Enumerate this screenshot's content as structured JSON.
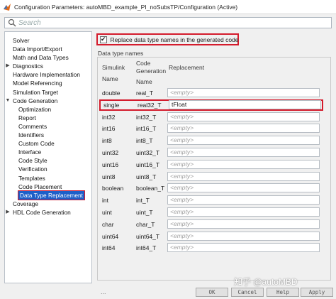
{
  "window": {
    "title": "Configuration Parameters: autoMBD_example_PI_noSubsTP/Configuration (Active)"
  },
  "search": {
    "placeholder": "Search"
  },
  "tree": {
    "items": [
      {
        "label": "Solver",
        "indent": 0,
        "toggle": ""
      },
      {
        "label": "Data Import/Export",
        "indent": 0,
        "toggle": ""
      },
      {
        "label": "Math and Data Types",
        "indent": 0,
        "toggle": ""
      },
      {
        "label": "Diagnostics",
        "indent": 0,
        "toggle": "▶"
      },
      {
        "label": "Hardware Implementation",
        "indent": 0,
        "toggle": ""
      },
      {
        "label": "Model Referencing",
        "indent": 0,
        "toggle": ""
      },
      {
        "label": "Simulation Target",
        "indent": 0,
        "toggle": ""
      },
      {
        "label": "Code Generation",
        "indent": 0,
        "toggle": "▼"
      },
      {
        "label": "Optimization",
        "indent": 1,
        "toggle": ""
      },
      {
        "label": "Report",
        "indent": 1,
        "toggle": ""
      },
      {
        "label": "Comments",
        "indent": 1,
        "toggle": ""
      },
      {
        "label": "Identifiers",
        "indent": 1,
        "toggle": ""
      },
      {
        "label": "Custom Code",
        "indent": 1,
        "toggle": ""
      },
      {
        "label": "Interface",
        "indent": 1,
        "toggle": ""
      },
      {
        "label": "Code Style",
        "indent": 1,
        "toggle": ""
      },
      {
        "label": "Verification",
        "indent": 1,
        "toggle": ""
      },
      {
        "label": "Templates",
        "indent": 1,
        "toggle": ""
      },
      {
        "label": "Code Placement",
        "indent": 1,
        "toggle": ""
      },
      {
        "label": "Data Type Replacement",
        "indent": 1,
        "toggle": "",
        "selected": true
      },
      {
        "label": "Coverage",
        "indent": 0,
        "toggle": ""
      },
      {
        "label": "HDL Code Generation",
        "indent": 0,
        "toggle": "▶"
      }
    ]
  },
  "replace_checkbox": {
    "checked": true,
    "label": "Replace data type names in the generated code"
  },
  "group": {
    "title": "Data type names",
    "headers": {
      "simulink": "Simulink",
      "simulink_2": "Name",
      "codegen": "Code",
      "codegen_2": "Generation",
      "codegen_3": "Name",
      "replacement": "Replacement"
    },
    "rows": [
      {
        "simulink": "double",
        "codegen": "real_T",
        "replacement": "",
        "placeholder": "<empty>"
      },
      {
        "simulink": "single",
        "codegen": "real32_T",
        "replacement": "tFloat",
        "placeholder": "<empty>",
        "highlight": true
      },
      {
        "simulink": "int32",
        "codegen": "int32_T",
        "replacement": "",
        "placeholder": "<empty>"
      },
      {
        "simulink": "int16",
        "codegen": "int16_T",
        "replacement": "",
        "placeholder": "<empty>"
      },
      {
        "simulink": "int8",
        "codegen": "int8_T",
        "replacement": "",
        "placeholder": "<empty>"
      },
      {
        "simulink": "uint32",
        "codegen": "uint32_T",
        "replacement": "",
        "placeholder": "<empty>"
      },
      {
        "simulink": "uint16",
        "codegen": "uint16_T",
        "replacement": "",
        "placeholder": "<empty>"
      },
      {
        "simulink": "uint8",
        "codegen": "uint8_T",
        "replacement": "",
        "placeholder": "<empty>"
      },
      {
        "simulink": "boolean",
        "codegen": "boolean_T",
        "replacement": "",
        "placeholder": "<empty>"
      },
      {
        "simulink": "int",
        "codegen": "int_T",
        "replacement": "",
        "placeholder": "<empty>"
      },
      {
        "simulink": "uint",
        "codegen": "uint_T",
        "replacement": "",
        "placeholder": "<empty>"
      },
      {
        "simulink": "char",
        "codegen": "char_T",
        "replacement": "",
        "placeholder": "<empty>"
      },
      {
        "simulink": "uint64",
        "codegen": "uint64_T",
        "replacement": "",
        "placeholder": "<empty>"
      },
      {
        "simulink": "int64",
        "codegen": "int64_T",
        "replacement": "",
        "placeholder": "<empty>"
      }
    ],
    "ellipsis": "..."
  },
  "buttons": {
    "ok": "OK",
    "cancel": "Cancel",
    "help": "Help",
    "apply": "Apply"
  },
  "watermark": "知乎 @autoMBD",
  "colors": {
    "highlight_border": "#d41b2c",
    "selection": "#1d5fc9"
  }
}
